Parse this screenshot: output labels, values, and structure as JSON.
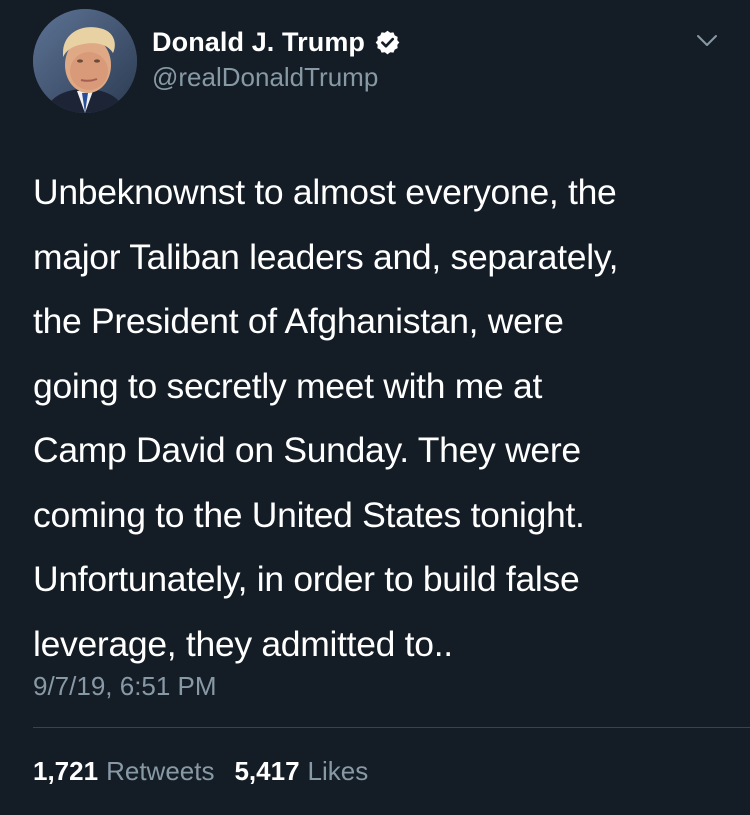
{
  "author": {
    "display_name": "Donald J. Trump",
    "handle": "@realDonaldTrump",
    "verified": true
  },
  "icons": {
    "verified": "verified-badge-icon",
    "menu": "chevron-down-icon"
  },
  "tweet": {
    "text": "Unbeknownst to almost everyone, the\nmajor Taliban leaders and, separately,\nthe President of Afghanistan, were\ngoing to secretly meet with me at\nCamp David on Sunday. They were\ncoming to the United States tonight.\nUnfortunately, in order to build false\nleverage, they admitted to..",
    "timestamp": "9/7/19, 6:51 PM"
  },
  "stats": {
    "retweets_count": "1,721",
    "retweets_label": "Retweets",
    "likes_count": "5,417",
    "likes_label": "Likes"
  },
  "colors": {
    "background": "#141d26",
    "text_primary": "#ffffff",
    "text_secondary": "#8899a6",
    "divider": "#38444d"
  }
}
